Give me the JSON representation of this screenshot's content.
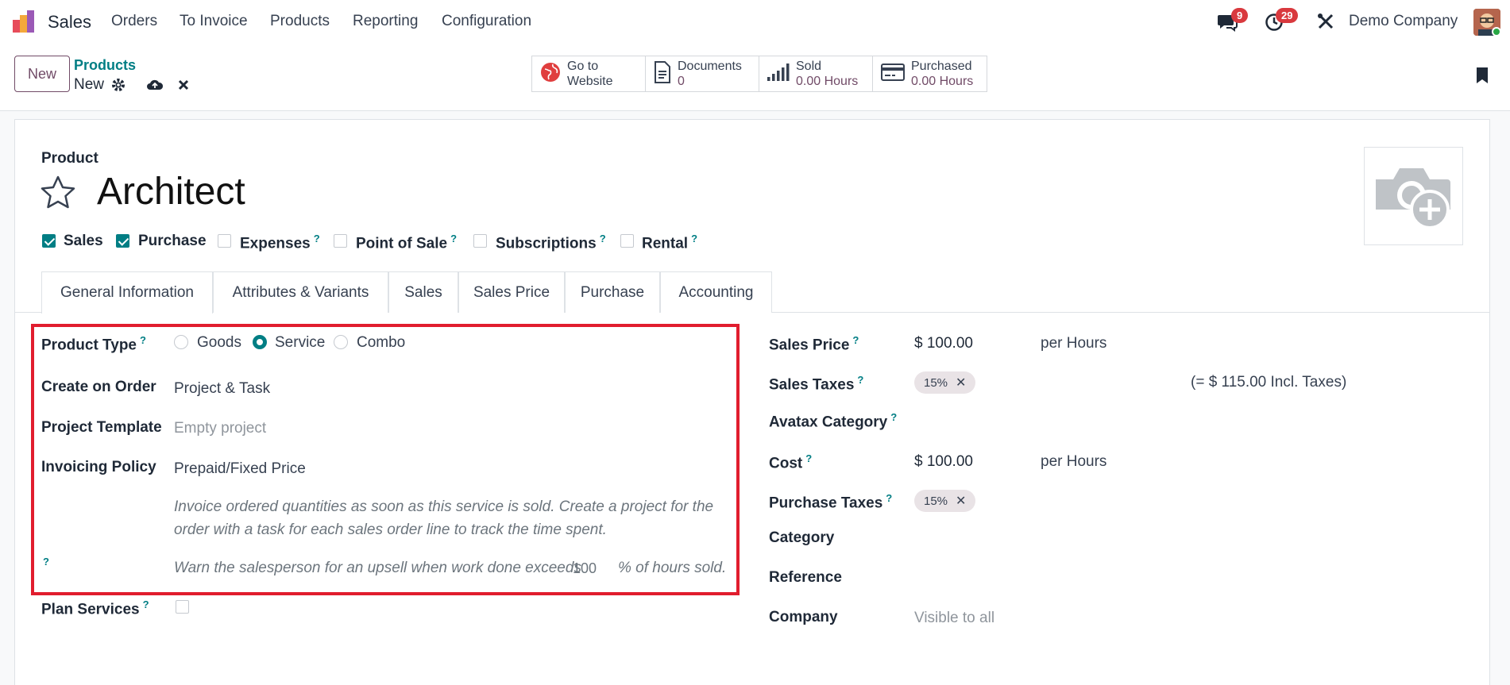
{
  "nav": {
    "app_name": "Sales",
    "menu": [
      "Orders",
      "To Invoice",
      "Products",
      "Reporting",
      "Configuration"
    ],
    "messages_count": "9",
    "activities_count": "29",
    "company": "Demo Company"
  },
  "control": {
    "new_label": "New",
    "breadcrumb_parent": "Products",
    "breadcrumb_current": "New"
  },
  "smart_buttons": {
    "website_line1": "Go to",
    "website_line2": "Website",
    "documents_label": "Documents",
    "documents_value": "0",
    "sold_label": "Sold",
    "sold_value": "0.00 Hours",
    "purchased_label": "Purchased",
    "purchased_value": "0.00 Hours"
  },
  "product": {
    "label": "Product",
    "name": "Architect"
  },
  "options": [
    {
      "label": "Sales",
      "checked": true,
      "help": ""
    },
    {
      "label": "Purchase",
      "checked": true,
      "help": ""
    },
    {
      "label": "Expenses",
      "checked": false,
      "help": "?"
    },
    {
      "label": "Point of Sale",
      "checked": false,
      "help": "?"
    },
    {
      "label": "Subscriptions",
      "checked": false,
      "help": "?"
    },
    {
      "label": "Rental",
      "checked": false,
      "help": "?"
    }
  ],
  "tabs": [
    "General Information",
    "Attributes & Variants",
    "Sales",
    "Sales Price",
    "Purchase",
    "Accounting"
  ],
  "left": {
    "product_type_label": "Product Type",
    "product_type_options": [
      "Goods",
      "Service",
      "Combo"
    ],
    "product_type_selected": "Service",
    "create_on_order_label": "Create on Order",
    "create_on_order_value": "Project & Task",
    "project_template_label": "Project Template",
    "project_template_placeholder": "Empty project",
    "invoicing_policy_label": "Invoicing Policy",
    "invoicing_policy_value": "Prepaid/Fixed Price",
    "invoicing_help_line1": "Invoice ordered quantities as soon as this service is sold. Create a project for the",
    "invoicing_help_line2": "order with a task for each sales order line to track the time spent.",
    "upsell_prefix": "Warn the salesperson for an upsell when work done exceeds",
    "upsell_value": "100",
    "upsell_suffix": "% of hours sold.",
    "plan_services_label": "Plan Services"
  },
  "right": {
    "sales_price_label": "Sales Price",
    "sales_price_value": "$ 100.00",
    "sales_price_uom": "per Hours",
    "sales_taxes_label": "Sales Taxes",
    "sales_taxes_tag": "15%",
    "sales_taxes_incl": "(= $ 115.00 Incl. Taxes)",
    "avatax_label": "Avatax Category",
    "cost_label": "Cost",
    "cost_value": "$ 100.00",
    "cost_uom": "per Hours",
    "purchase_taxes_label": "Purchase Taxes",
    "purchase_taxes_tag": "15%",
    "category_label": "Category",
    "reference_label": "Reference",
    "company_label": "Company",
    "company_placeholder": "Visible to all"
  },
  "colors": {
    "brand": "#714b67",
    "accent": "#017e84",
    "highlight": "#e11d2e",
    "badge": "#d9393e"
  }
}
